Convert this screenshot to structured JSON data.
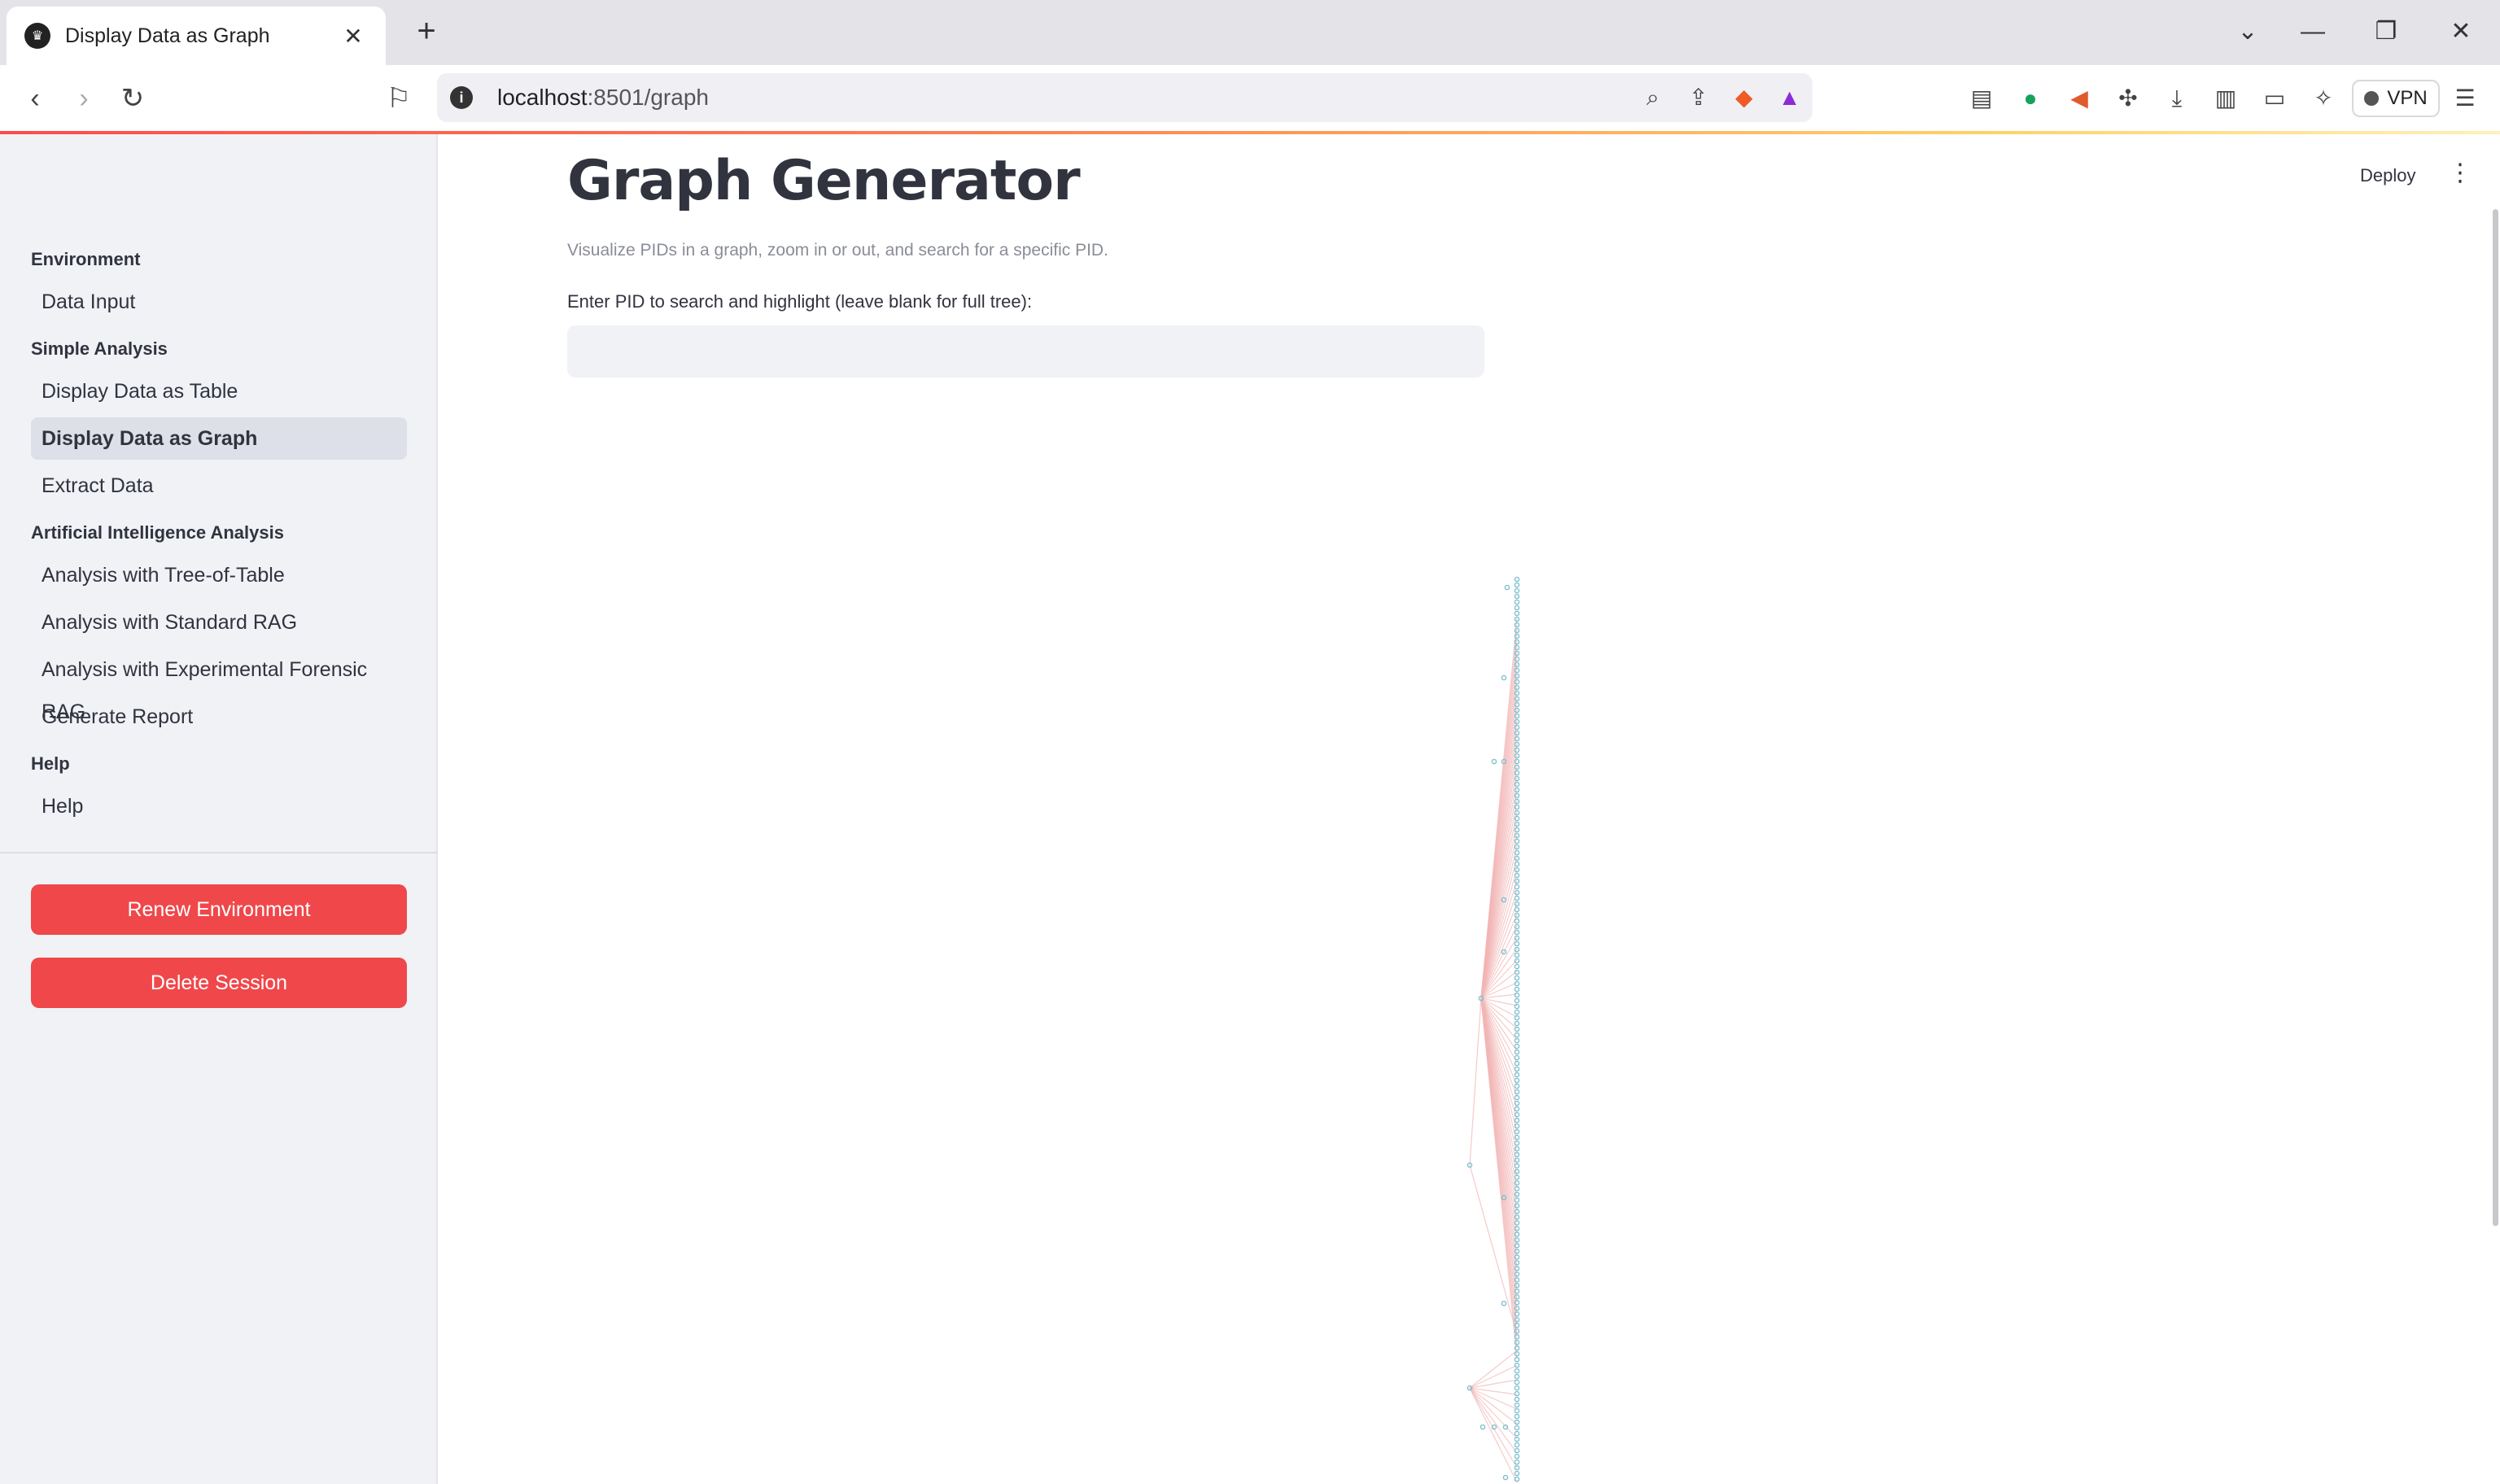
{
  "browser": {
    "tab_title": "Display Data as Graph",
    "url_host": "localhost",
    "url_rest": ":8501/graph",
    "vpn_label": "VPN"
  },
  "sidebar": {
    "sections": [
      {
        "title": "Environment",
        "items": [
          "Data Input"
        ]
      },
      {
        "title": "Simple Analysis",
        "items": [
          "Display Data as Table",
          "Display Data as Graph",
          "Extract Data"
        ]
      },
      {
        "title": "Artificial Intelligence Analysis",
        "items": [
          "Analysis with Tree-of-Table",
          "Analysis with Standard RAG",
          "Analysis with Experimental Forensic RAG",
          "Generate Report"
        ]
      },
      {
        "title": "Help",
        "items": [
          "Help"
        ]
      }
    ],
    "active_item": "Display Data as Graph",
    "renew_button": "Renew Environment",
    "delete_button": "Delete Session"
  },
  "main": {
    "deploy_label": "Deploy",
    "title": "Graph Generator",
    "caption": "Visualize PIDs in a graph, zoom in or out, and search for a specific PID.",
    "input_label": "Enter PID to search and highlight (leave blank for full tree):",
    "input_value": "",
    "input_placeholder": ""
  },
  "colors": {
    "accent": "#ff4b4b",
    "button_red": "#f0474a",
    "node": "#7fc2d0",
    "edge": "#f3b4b4",
    "sidebar_bg": "#f0f2f6"
  }
}
